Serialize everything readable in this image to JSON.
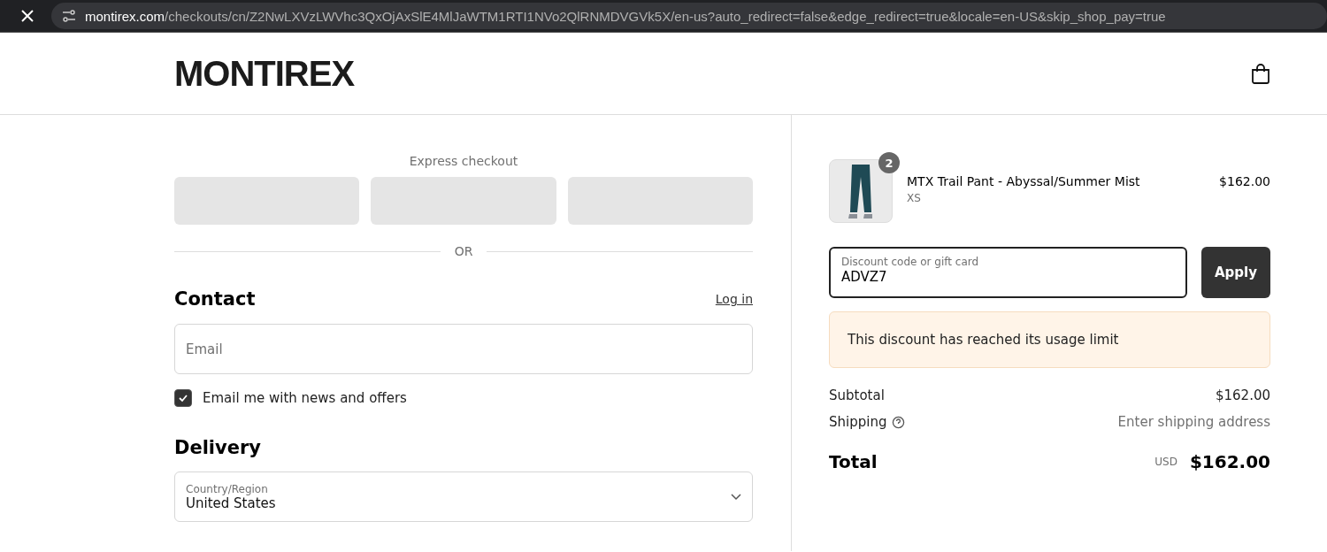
{
  "browser": {
    "url_host": "montirex.com",
    "url_path": "/checkouts/cn/Z2NwLXVzLWVhc3QxOjAxSlE4MlJaWTM1RTI1NVo2QlRNMDVGVk5X/en-us?auto_redirect=false&edge_redirect=true&locale=en-US&skip_shop_pay=true"
  },
  "header": {
    "logo": "MONTIREX"
  },
  "express": {
    "title": "Express checkout",
    "buttons": [
      {
        "kind": "wallet"
      },
      {
        "kind": "wallet"
      },
      {
        "kind": "wallet"
      }
    ],
    "divider": "OR"
  },
  "contact": {
    "title": "Contact",
    "login": "Log in",
    "email": {
      "placeholder": "Email"
    },
    "newsletter": {
      "label": "Email me with news and offers",
      "checked": true
    }
  },
  "delivery": {
    "title": "Delivery",
    "country": {
      "label": "Country/Region",
      "value": "United States"
    }
  },
  "cart": {
    "items": [
      {
        "name": "MTX Trail Pant - Abyssal/Summer Mist",
        "variant": "XS",
        "quantity": "2",
        "price": "$162.00"
      }
    ],
    "discount": {
      "label": "Discount code or gift card",
      "value": "ADVZ7",
      "button": "Apply",
      "error": "This discount has reached its usage limit"
    },
    "subtotal": {
      "label": "Subtotal",
      "value": "$162.00"
    },
    "shipping": {
      "label": "Shipping",
      "value": "Enter shipping address"
    },
    "total": {
      "label": "Total",
      "currency": "USD",
      "value": "$162.00"
    }
  }
}
